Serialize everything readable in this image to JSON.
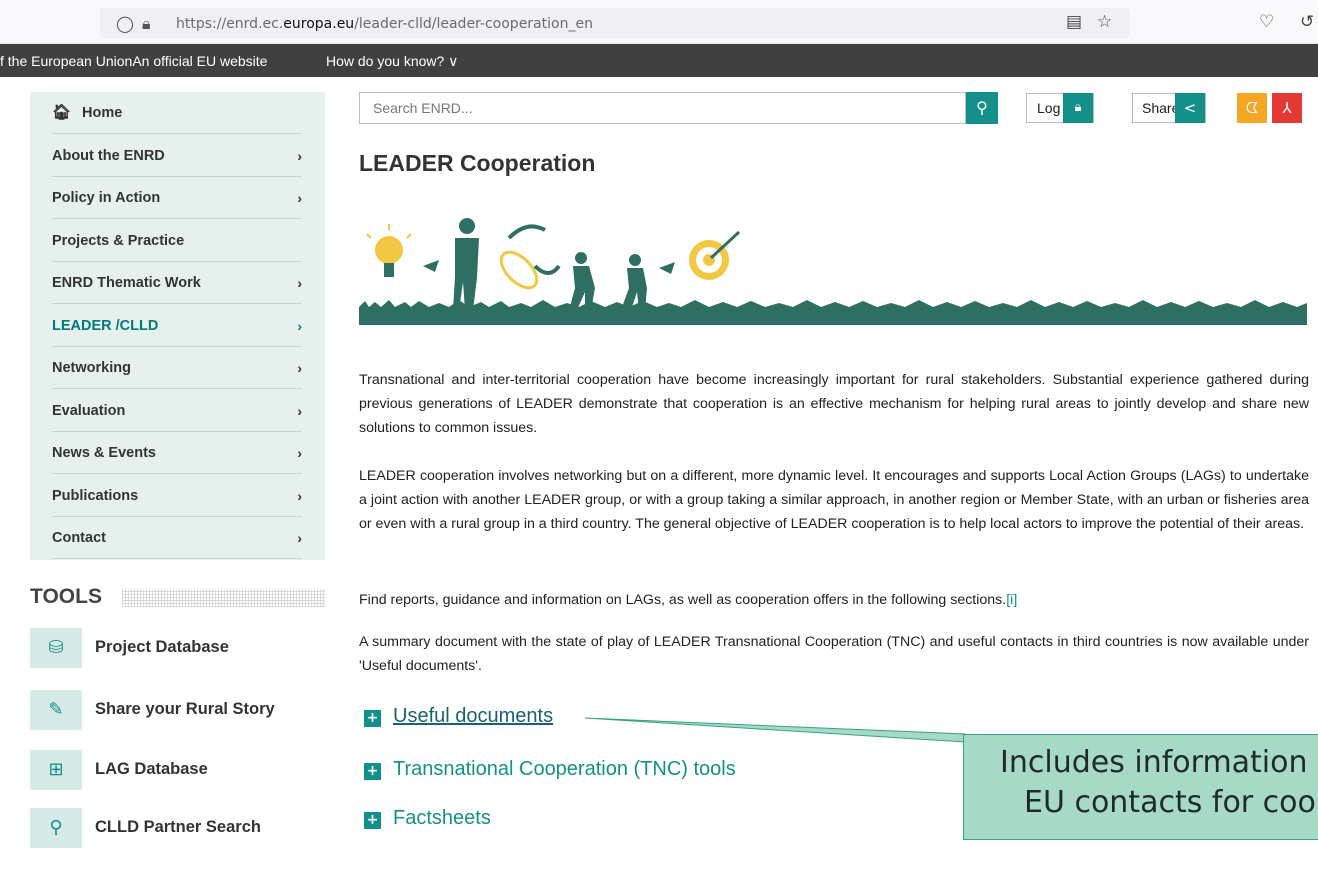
{
  "browser": {
    "url_prefix": "https://enrd.ec.",
    "url_domain": "europa.eu",
    "url_suffix": "/leader-clld/leader-cooperation_en"
  },
  "eu_bar": {
    "text": "f the European UnionAn official EU website",
    "how_label": "How do you know? ∨"
  },
  "sidebar": {
    "home_label": "Home",
    "items": [
      {
        "label": "About the ENRD",
        "chevron": true
      },
      {
        "label": "Policy in Action",
        "chevron": true
      },
      {
        "label": "Projects & Practice",
        "chevron": false
      },
      {
        "label": "ENRD Thematic Work",
        "chevron": true
      },
      {
        "label": "LEADER /CLLD",
        "chevron": true,
        "active": true
      },
      {
        "label": "Networking",
        "chevron": true
      },
      {
        "label": "Evaluation",
        "chevron": true
      },
      {
        "label": "News & Events",
        "chevron": true
      },
      {
        "label": "Publications",
        "chevron": true
      },
      {
        "label": "Contact",
        "chevron": true
      }
    ],
    "chevron_glyph": "›"
  },
  "tools": {
    "title": "TOOLS",
    "items": [
      {
        "label": "Project Database",
        "icon": "database-icon"
      },
      {
        "label": "Share your Rural Story",
        "icon": "chat-icon"
      },
      {
        "label": "LAG Database",
        "icon": "file-plus-icon"
      },
      {
        "label": "CLLD Partner Search",
        "icon": "partner-search-icon"
      }
    ]
  },
  "header": {
    "search_placeholder": "Search ENRD...",
    "login_label": "Log in",
    "share_label": "Share"
  },
  "main": {
    "title": "LEADER Cooperation",
    "paragraphs": [
      "Transnational and inter-territorial cooperation have become increasingly important for rural stakeholders. Substantial experience gathered during previous generations of LEADER demonstrate that cooperation is an effective mechanism for helping rural areas to jointly develop and share new solutions to common issues.",
      "LEADER cooperation involves networking but on a different, more dynamic level. It encourages and supports Local Action Groups (LAGs) to undertake a joint action with another LEADER group, or with a group taking a similar approach, in another region or Member State, with an urban or fisheries area or even with a rural group in a third country. The general objective of LEADER cooperation is to help local actors to improve the potential of their areas.",
      "A summary document with the state of play of LEADER Transnational Cooperation (TNC) and useful contacts in third countries is now available under 'Useful documents'."
    ],
    "find_text": "Find reports, guidance and information on LAGs, as well as cooperation offers in the following sections.",
    "footnote_link": "[i]",
    "accordions": [
      {
        "label": "Useful documents"
      },
      {
        "label": "Transnational Cooperation (TNC) tools"
      },
      {
        "label": "Factsheets"
      }
    ]
  },
  "callout": {
    "line1": "Includes information",
    "line2": "EU contacts for coop"
  },
  "colors": {
    "accent": "#13908a",
    "sidebar_bg": "#e6f1ee",
    "callout_bg": "#a6dac6",
    "rss": "#f5a623",
    "pdf": "#e53935"
  }
}
